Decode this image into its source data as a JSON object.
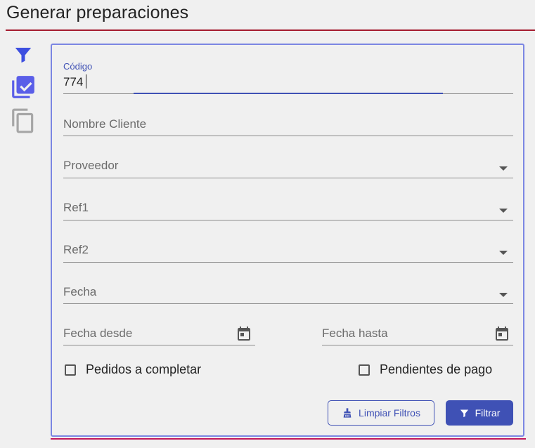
{
  "header": {
    "title": "Generar preparaciones"
  },
  "side_icons": [
    "filter-icon",
    "checklist-icon",
    "copy-icon"
  ],
  "form": {
    "codigo": {
      "label": "Código",
      "value": "774"
    },
    "nombre_cliente": {
      "placeholder": "Nombre Cliente"
    },
    "proveedor": {
      "placeholder": "Proveedor"
    },
    "ref1": {
      "placeholder": "Ref1"
    },
    "ref2": {
      "placeholder": "Ref2"
    },
    "fecha": {
      "placeholder": "Fecha"
    },
    "fecha_desde": {
      "placeholder": "Fecha desde"
    },
    "fecha_hasta": {
      "placeholder": "Fecha hasta"
    },
    "pedidos_completar": {
      "label": "Pedidos a completar",
      "checked": false
    },
    "pendientes_pago": {
      "label": "Pendientes de pago",
      "checked": false
    }
  },
  "actions": {
    "limpiar": "Limpiar Filtros",
    "filtrar": "Filtrar"
  },
  "colors": {
    "accent": "#3f51b5",
    "title_rule": "#a51c30",
    "panel_border": "#7b86e3"
  }
}
